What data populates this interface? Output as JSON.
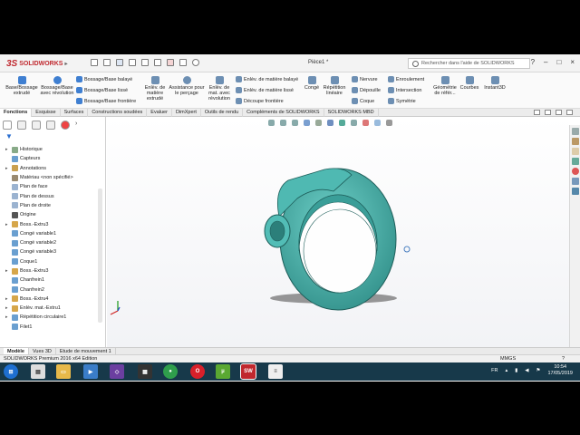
{
  "app": {
    "logo_text": "SOLIDWORKS",
    "document_title": "Pièce1 *",
    "search_placeholder": "Rechercher dans l'aide de SOLIDWORKS",
    "window_buttons": [
      "?",
      "–",
      "□",
      "×"
    ]
  },
  "ribbon": {
    "large_buttons": [
      {
        "label": "Base/Bossage extrudé",
        "icon": "extrude-boss-icon",
        "color": "#3f7fd1"
      },
      {
        "label": "Bossage/Base avec révolution",
        "icon": "revolve-boss-icon",
        "color": "#3f7fd1"
      },
      {
        "label": "Enlèv. de matière extrudé",
        "icon": "extruded-cut-icon",
        "color": "#6d8fb3"
      },
      {
        "label": "Assistance pour le perçage",
        "icon": "hole-wizard-icon",
        "color": "#6d8fb3"
      },
      {
        "label": "Enlèv. de mat. avec révolution",
        "icon": "revolved-cut-icon",
        "color": "#6d8fb3"
      },
      {
        "label": "Congé",
        "icon": "fillet-icon",
        "color": "#6d8fb3"
      },
      {
        "label": "Répétition linéaire",
        "icon": "linear-pattern-icon",
        "color": "#6d8fb3"
      },
      {
        "label": "Géométrie de référ...",
        "icon": "reference-geometry-icon",
        "color": "#6d8fb3"
      },
      {
        "label": "Courbes",
        "icon": "curves-icon",
        "color": "#6d8fb3"
      },
      {
        "label": "Instant3D",
        "icon": "instant3d-icon",
        "color": "#6d8fb3"
      }
    ],
    "small_buttons": [
      {
        "label": "Bossage/Base balayé",
        "icon": "swept-boss-icon"
      },
      {
        "label": "Bossage/Base lissé",
        "icon": "lofted-boss-icon"
      },
      {
        "label": "Bossage/Base frontière",
        "icon": "boundary-boss-icon"
      },
      {
        "label": "Enlèv. de matière balayé",
        "icon": "swept-cut-icon"
      },
      {
        "label": "Enlèv. de matière lissé",
        "icon": "lofted-cut-icon"
      },
      {
        "label": "Découpe frontière",
        "icon": "boundary-cut-icon"
      },
      {
        "label": "Nervure",
        "icon": "rib-icon"
      },
      {
        "label": "Dépouille",
        "icon": "draft-icon"
      },
      {
        "label": "Coque",
        "icon": "shell-icon"
      },
      {
        "label": "Enroulement",
        "icon": "wrap-icon"
      },
      {
        "label": "Intersection",
        "icon": "intersect-icon"
      },
      {
        "label": "Symétrie",
        "icon": "mirror-icon"
      }
    ]
  },
  "tabs": [
    {
      "label": "Fonctions",
      "active": true
    },
    {
      "label": "Esquisse",
      "active": false
    },
    {
      "label": "Surfaces",
      "active": false
    },
    {
      "label": "Constructions soudées",
      "active": false
    },
    {
      "label": "Evaluer",
      "active": false
    },
    {
      "label": "DimXpert",
      "active": false
    },
    {
      "label": "Outils de rendu",
      "active": false
    },
    {
      "label": "Compléments de SOLIDWORKS",
      "active": false
    },
    {
      "label": "SOLIDWORKS MBD",
      "active": false
    }
  ],
  "tree": [
    {
      "label": "Historique",
      "icon": "history-icon",
      "expander": "▸"
    },
    {
      "label": "Capteurs",
      "icon": "sensors-icon",
      "expander": ""
    },
    {
      "label": "Annotations",
      "icon": "annotations-icon",
      "expander": "▸"
    },
    {
      "label": "Matériau <non spécifié>",
      "icon": "material-icon",
      "expander": ""
    },
    {
      "label": "Plan de face",
      "icon": "plane-icon",
      "expander": ""
    },
    {
      "label": "Plan de dessus",
      "icon": "plane-icon",
      "expander": ""
    },
    {
      "label": "Plan de droite",
      "icon": "plane-icon",
      "expander": ""
    },
    {
      "label": "Origine",
      "icon": "origin-icon",
      "expander": ""
    },
    {
      "label": "Boss.-Extru3",
      "icon": "extrude-feature-icon",
      "expander": "▸"
    },
    {
      "label": "Congé variable1",
      "icon": "fillet-feature-icon",
      "expander": ""
    },
    {
      "label": "Congé variable2",
      "icon": "fillet-feature-icon",
      "expander": ""
    },
    {
      "label": "Congé variable3",
      "icon": "fillet-feature-icon",
      "expander": ""
    },
    {
      "label": "Coque1",
      "icon": "shell-feature-icon",
      "expander": ""
    },
    {
      "label": "Boss.-Extru3",
      "icon": "extrude-feature-icon",
      "expander": "▸"
    },
    {
      "label": "Chanfrein1",
      "icon": "chamfer-feature-icon",
      "expander": ""
    },
    {
      "label": "Chanfrein2",
      "icon": "chamfer-feature-icon",
      "expander": ""
    },
    {
      "label": "Boss.-Extru4",
      "icon": "extrude-feature-icon",
      "expander": "▸"
    },
    {
      "label": "Enlèv. mat.-Extru1",
      "icon": "cut-feature-icon",
      "expander": "▸"
    },
    {
      "label": "Répétition circulaire1",
      "icon": "circular-pattern-icon",
      "expander": "▸"
    },
    {
      "label": "Filet1",
      "icon": "thread-feature-icon",
      "expander": ""
    }
  ],
  "bottom_tabs": [
    {
      "label": "Modèle",
      "active": true
    },
    {
      "label": "Vues 3D",
      "active": false
    },
    {
      "label": "Etude de mouvement 1",
      "active": false
    }
  ],
  "status": {
    "edition": "SOLIDWORKS Premium 2016 x64 Edition",
    "units": "MMGS"
  },
  "taskbar": {
    "language": "FR",
    "time": "10:54",
    "date": "17/05/2019"
  },
  "colors": {
    "model": "#47b2ab",
    "model_dark": "#2f8d87",
    "brand_red": "#c0282e",
    "taskbar": "#17394a"
  }
}
